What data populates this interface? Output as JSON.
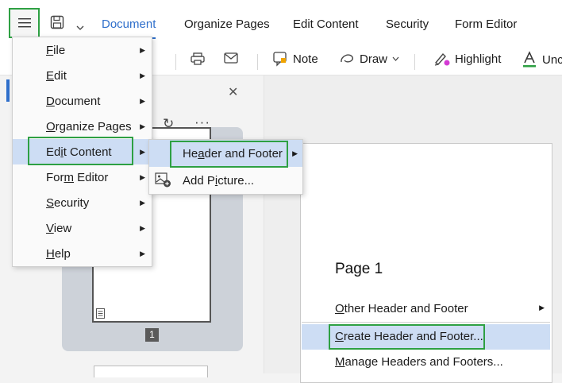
{
  "tabs": {
    "document": "Document",
    "organize": "Organize Pages",
    "edit_content": "Edit Content",
    "security": "Security",
    "form_editor": "Form Editor"
  },
  "ribbon": {
    "note": "Note",
    "draw": "Draw",
    "highlight": "Highlight",
    "underline": "Unc"
  },
  "thumbnail": {
    "page_number": "1"
  },
  "document": {
    "page_title": "Page 1"
  },
  "main_menu": {
    "items": [
      {
        "pre": "",
        "u": "F",
        "post": "ile"
      },
      {
        "pre": "",
        "u": "E",
        "post": "dit"
      },
      {
        "pre": "",
        "u": "D",
        "post": "ocument"
      },
      {
        "pre": "",
        "u": "O",
        "post": "rganize Pages"
      },
      {
        "pre": "Ed",
        "u": "i",
        "post": "t Content"
      },
      {
        "pre": "For",
        "u": "m",
        "post": " Editor"
      },
      {
        "pre": "",
        "u": "S",
        "post": "ecurity"
      },
      {
        "pre": "",
        "u": "V",
        "post": "iew"
      },
      {
        "pre": "",
        "u": "H",
        "post": "elp"
      }
    ]
  },
  "edit_content_menu": {
    "header_footer": {
      "pre": "He",
      "u": "a",
      "post": "der and Footer"
    },
    "add_picture": {
      "pre": "Add P",
      "u": "i",
      "post": "cture..."
    }
  },
  "header_footer_menu": {
    "other": {
      "pre": "",
      "u": "O",
      "post": "ther Header and Footer"
    },
    "create": {
      "pre": "",
      "u": "C",
      "post": "reate Header and Footer..."
    },
    "manage": {
      "pre": "",
      "u": "M",
      "post": "anage Headers and Footers..."
    }
  },
  "colors": {
    "accent": "#2f6fcb",
    "highlight_box": "#2ea043",
    "menu_hover": "#cdddf4"
  }
}
